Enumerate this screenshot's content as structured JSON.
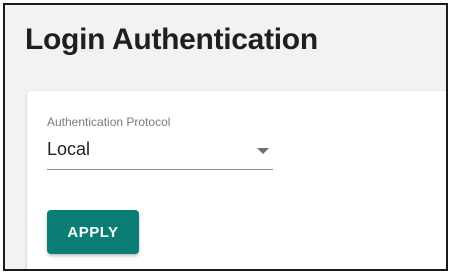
{
  "header": {
    "title": "Login Authentication"
  },
  "form": {
    "auth_protocol": {
      "label": "Authentication Protocol",
      "value": "Local",
      "caret_icon": "chevron-down-icon"
    },
    "apply_label": "APPLY"
  },
  "colors": {
    "accent": "#0a7e74",
    "page_background": "#f2f2f2",
    "card_background": "#ffffff",
    "title_text": "#1f1f1f"
  }
}
